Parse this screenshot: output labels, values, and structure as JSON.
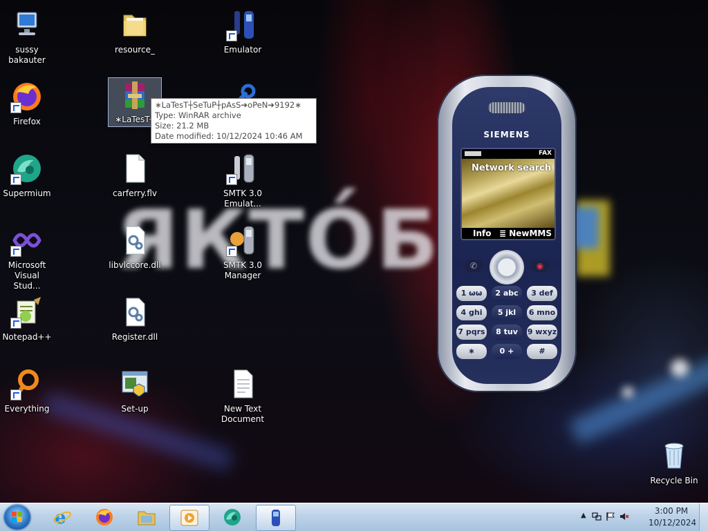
{
  "desktop": {
    "icons": [
      {
        "label": "sussy\nbakauter",
        "icon": "computer-icon"
      },
      {
        "label": "Firefox",
        "icon": "firefox-icon"
      },
      {
        "label": "Supermium",
        "icon": "supermium-icon"
      },
      {
        "label": "Microsoft Visual Stud...",
        "icon": "visual-studio-icon"
      },
      {
        "label": "Notepad++",
        "icon": "notepad-plus-plus-icon"
      },
      {
        "label": "Everything",
        "icon": "everything-icon"
      },
      {
        "label": "resource_",
        "icon": "folder-icon"
      },
      {
        "label": "∗LaTesT┼",
        "icon": "winrar-archive-icon"
      },
      {
        "label": "carferry.flv",
        "icon": "file-icon"
      },
      {
        "label": "libvlccore.dll",
        "icon": "dll-file-icon"
      },
      {
        "label": "Register.dll",
        "icon": "dll-file-icon"
      },
      {
        "label": "Set-up",
        "icon": "setup-installer-icon"
      },
      {
        "label": "Emulator",
        "icon": "emulator-icon"
      },
      {
        "label": "SMTK 3.0 Emulat...",
        "icon": "emulator-icon"
      },
      {
        "label": "SMTK 3.0 Manager",
        "icon": "smtk-manager-icon"
      },
      {
        "label": "New Text Document",
        "icon": "text-document-icon"
      },
      {
        "label": "Recycle Bin",
        "icon": "recycle-bin-icon"
      }
    ]
  },
  "wallpaper_text": "ЯКТО́Б",
  "tooltip": {
    "name": "∗LaTesT┼SeTuP┼pAsS➔oPeN➔9192∗",
    "type": "Type: WinRAR archive",
    "size": "Size: 21.2 MB",
    "modified": "Date modified: 10/12/2024 10:46 AM"
  },
  "phone": {
    "brand": "SIEMENS",
    "screen_status": "Network search",
    "fax_indicator": "FAX",
    "softkey_left": "Info",
    "softkey_right": "≣ NewMMS",
    "keys": [
      [
        "1 ωω",
        "2 abc",
        "3 def"
      ],
      [
        "4 ghi",
        "5 jkl",
        "6 mno"
      ],
      [
        "7 pqrs",
        "8 tuv",
        "9 wxyz"
      ],
      [
        "∗",
        "0 +",
        "#"
      ]
    ]
  },
  "taskbar": {
    "pinned": [
      "start-button",
      "internet-explorer-icon",
      "firefox-icon",
      "file-explorer-icon",
      "media-player-icon",
      "supermium-icon",
      "emulator-icon"
    ],
    "clock_time": "3:00 PM",
    "clock_date": "10/12/2024"
  }
}
